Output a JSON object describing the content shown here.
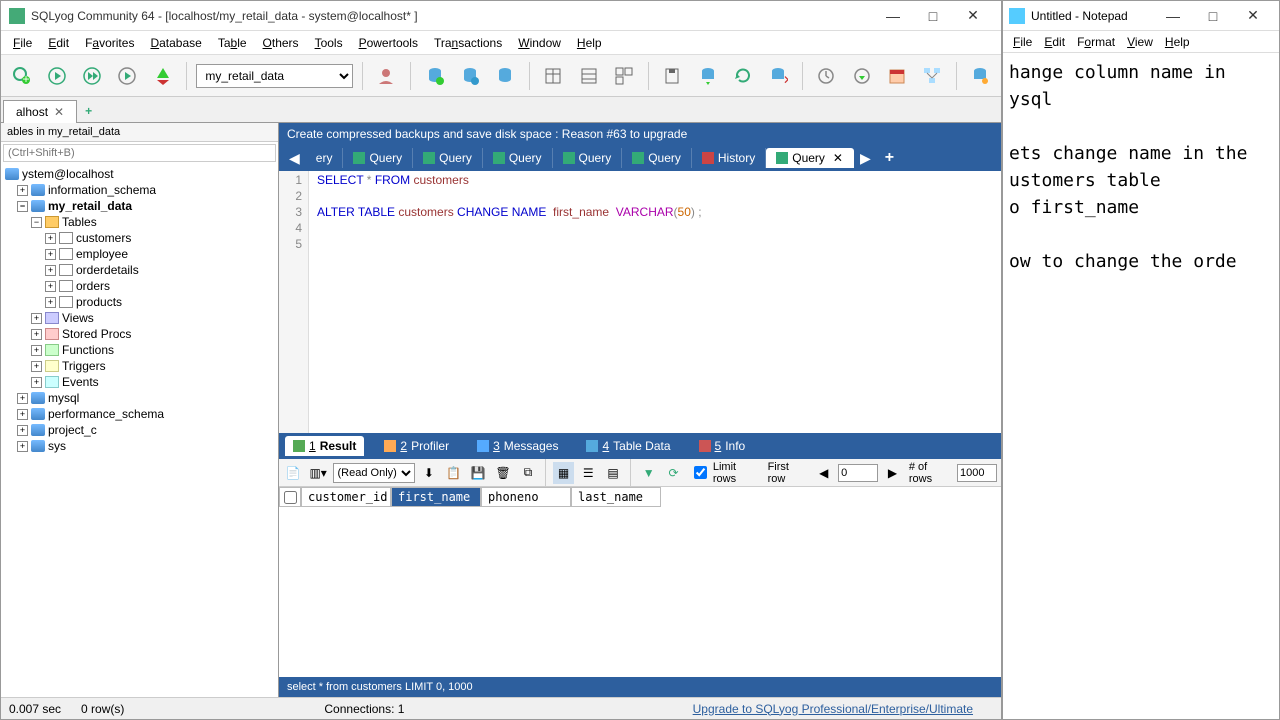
{
  "sqlyog": {
    "title": "SQLyog Community 64 - [localhost/my_retail_data - system@localhost* ]",
    "menus": [
      "File",
      "Edit",
      "Favorites",
      "Database",
      "Table",
      "Others",
      "Tools",
      "Powertools",
      "Transactions",
      "Window",
      "Help"
    ],
    "db_selector": "my_retail_data",
    "conn_tab": "alhost",
    "sidebar_header": "ables in my_retail_data",
    "filter_placeholder": "(Ctrl+Shift+B)",
    "tree": {
      "root": "ystem@localhost",
      "dbs": [
        {
          "name": "information_schema"
        },
        {
          "name": "my_retail_data",
          "bold": true,
          "expanded": true,
          "children": {
            "tables_label": "Tables",
            "tables": [
              "customers",
              "employee",
              "orderdetails",
              "orders",
              "products"
            ],
            "views": "Views",
            "stored_procs": "Stored Procs",
            "functions": "Functions",
            "triggers": "Triggers",
            "events": "Events"
          }
        },
        {
          "name": "mysql"
        },
        {
          "name": "performance_schema"
        },
        {
          "name": "project_c"
        },
        {
          "name": "sys"
        }
      ]
    },
    "promo": "Create compressed backups and save disk space : Reason #63 to upgrade",
    "query_tabs": {
      "hidden_first": "ery",
      "labels": [
        "Query",
        "Query",
        "Query",
        "Query",
        "Query"
      ],
      "history": "History",
      "active": "Query"
    },
    "code_lines": [
      {
        "n": "1",
        "tokens": [
          [
            "kw",
            "SELECT"
          ],
          [
            "op",
            " * "
          ],
          [
            "kw",
            "FROM"
          ],
          [
            "id",
            " customers"
          ]
        ]
      },
      {
        "n": "2",
        "tokens": []
      },
      {
        "n": "3",
        "tokens": [
          [
            "kw",
            "ALTER TABLE"
          ],
          [
            "id",
            " customers "
          ],
          [
            "kw",
            "CHANGE NAME"
          ],
          [
            "id",
            "  first_name  "
          ],
          [
            "fn",
            "VARCHAR"
          ],
          [
            "op",
            "("
          ],
          [
            "num",
            "50"
          ],
          [
            "op",
            ") ;"
          ]
        ]
      },
      {
        "n": "4",
        "tokens": []
      },
      {
        "n": "5",
        "tokens": []
      }
    ],
    "result_tabs": [
      {
        "key": "1",
        "label": "Result",
        "active": true,
        "bold": true
      },
      {
        "key": "2",
        "label": "Profiler"
      },
      {
        "key": "3",
        "label": "Messages"
      },
      {
        "key": "4",
        "label": "Table Data"
      },
      {
        "key": "5",
        "label": "Info"
      }
    ],
    "result_toolbar": {
      "mode": "(Read Only)",
      "limit_rows_label": "Limit rows",
      "first_row_label": "First row",
      "first_row_value": "0",
      "num_rows_label": "# of rows",
      "num_rows_value": "1000"
    },
    "result_columns": [
      "customer_id",
      "first_name",
      "phoneno",
      "last_name"
    ],
    "selected_column": "first_name",
    "footer_query": "select * from customers LIMIT 0, 1000",
    "status": {
      "time": "0.007 sec",
      "rows": "0 row(s)",
      "connections": "Connections: 1",
      "upgrade": "Upgrade to SQLyog Professional/Enterprise/Ultimate"
    }
  },
  "notepad": {
    "title": "Untitled - Notepad",
    "menus": [
      "File",
      "Edit",
      "Format",
      "View",
      "Help"
    ],
    "body": "hange column name in\nysql\n\nets change name in the\nustomers table\no first_name\n\now to change the orde"
  }
}
